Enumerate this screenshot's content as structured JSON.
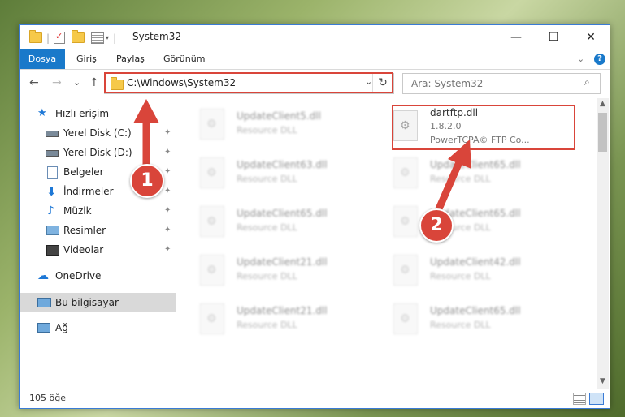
{
  "window": {
    "title": "System32",
    "controls": {
      "minimize": "—",
      "maximize": "☐",
      "close": "✕"
    }
  },
  "ribbon": {
    "tabs": [
      "Dosya",
      "Giriş",
      "Paylaş",
      "Görünüm"
    ],
    "collapse": "⌄",
    "help": "?"
  },
  "nav": {
    "back": "←",
    "forward": "→",
    "recent": "⌄",
    "up": "↑",
    "address": "C:\\Windows\\System32",
    "dropdown": "⌄",
    "refresh": "↻",
    "search_placeholder": "Ara: System32",
    "search_icon": "magnifier-icon"
  },
  "sidebar": {
    "items": [
      {
        "label": "Hızlı erişim",
        "icon": "star-icon",
        "pinned": false
      },
      {
        "label": "Yerel Disk (C:)",
        "icon": "drive-icon",
        "pinned": true
      },
      {
        "label": "Yerel Disk (D:)",
        "icon": "drive-icon",
        "pinned": true
      },
      {
        "label": "Belgeler",
        "icon": "documents-icon",
        "pinned": true
      },
      {
        "label": "İndirmeler",
        "icon": "download-icon",
        "pinned": true
      },
      {
        "label": "Müzik",
        "icon": "music-icon",
        "pinned": true
      },
      {
        "label": "Resimler",
        "icon": "pictures-icon",
        "pinned": true
      },
      {
        "label": "Videolar",
        "icon": "video-icon",
        "pinned": true
      },
      {
        "label": "OneDrive",
        "icon": "cloud-icon",
        "pinned": false
      },
      {
        "label": "Bu bilgisayar",
        "icon": "computer-icon",
        "pinned": false,
        "selected": true
      },
      {
        "label": "Ağ",
        "icon": "network-icon",
        "pinned": false
      }
    ],
    "pin_glyph": "📌"
  },
  "files": [
    {
      "name": "UpdateClient5.dll",
      "type": "Resource DLL",
      "blurred": true
    },
    {
      "name": "dartftp.dll",
      "version": "1.8.2.0",
      "company": "PowerTCPA© FTP Co...",
      "blurred": false,
      "highlighted": true
    },
    {
      "name": "UpdateClient63.dll",
      "type": "Resource DLL",
      "blurred": true
    },
    {
      "name": "UpdateClient65.dll",
      "type": "Resource DLL",
      "blurred": true
    },
    {
      "name": "UpdateClient65.dll",
      "type": "Resource DLL",
      "blurred": true
    },
    {
      "name": "UpdateClient65.dll",
      "type": "Resource DLL",
      "blurred": true
    },
    {
      "name": "UpdateClient21.dll",
      "type": "Resource DLL",
      "blurred": true
    },
    {
      "name": "UpdateClient42.dll",
      "type": "Resource DLL",
      "blurred": true
    },
    {
      "name": "UpdateClient21.dll",
      "type": "Resource DLL",
      "blurred": true
    },
    {
      "name": "UpdateClient65.dll",
      "type": "Resource DLL",
      "blurred": true
    }
  ],
  "status": {
    "count": "105 öğe"
  },
  "annotations": {
    "step1": "1",
    "step2": "2",
    "color": "#d9453a"
  }
}
